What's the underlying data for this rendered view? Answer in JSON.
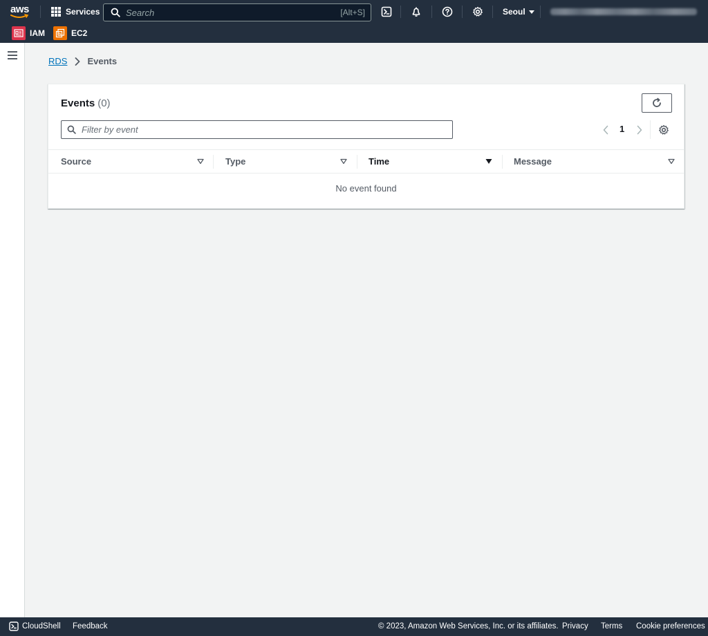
{
  "topnav": {
    "logo_text": "aws",
    "services_label": "Services",
    "search_placeholder": "Search",
    "search_shortcut": "[Alt+S]",
    "region": "Seoul",
    "favorites": [
      {
        "label": "IAM",
        "color": "#dd344c"
      },
      {
        "label": "EC2",
        "color": "#ed7100"
      }
    ]
  },
  "breadcrumb": {
    "root": "RDS",
    "current": "Events"
  },
  "panel": {
    "title": "Events",
    "count": "(0)",
    "filter_placeholder": "Filter by event",
    "page": "1",
    "columns": [
      "Source",
      "Type",
      "Time",
      "Message"
    ],
    "empty_text": "No event found"
  },
  "footer": {
    "cloudshell": "CloudShell",
    "feedback": "Feedback",
    "copyright": "© 2023, Amazon Web Services, Inc. or its affiliates.",
    "privacy": "Privacy",
    "terms": "Terms",
    "cookies": "Cookie preferences"
  },
  "colors": {
    "nav_bg": "#232f3e",
    "link": "#0073bb",
    "page_bg": "#f2f3f3"
  }
}
